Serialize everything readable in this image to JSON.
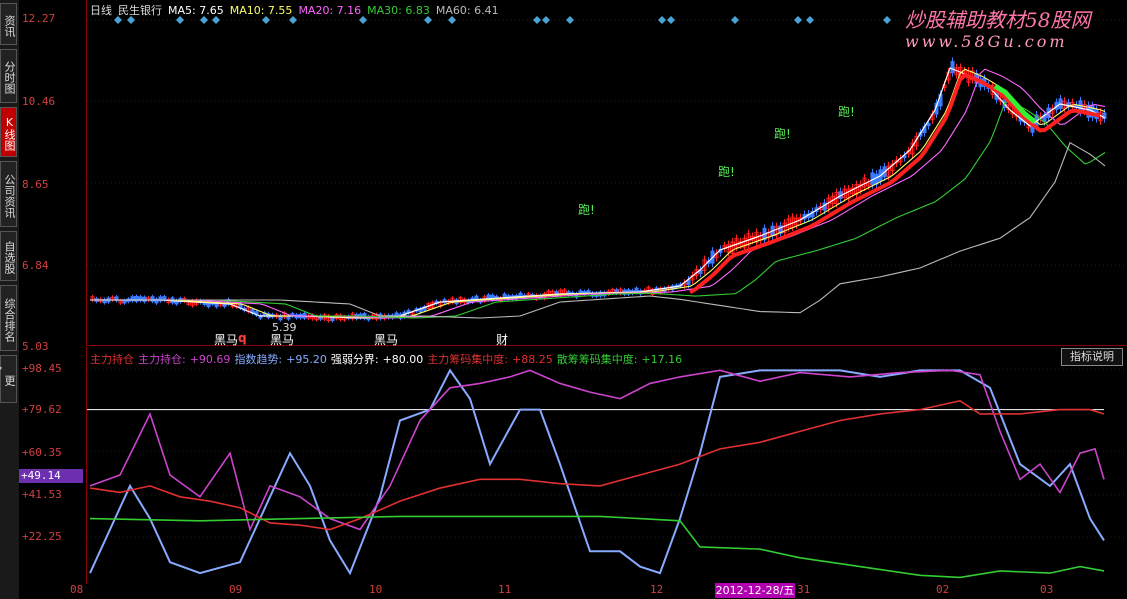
{
  "side_tabs": [
    {
      "label": "资讯",
      "active": false
    },
    {
      "label": "分时图",
      "active": false
    },
    {
      "label": "K线图",
      "active": true
    },
    {
      "label": "公司资讯",
      "active": false
    },
    {
      "label": "自选股",
      "active": false
    },
    {
      "label": "综合排名",
      "active": false
    },
    {
      "label": "更多..",
      "active": false
    }
  ],
  "main_legend": {
    "period": "日线",
    "stock": "民生银行",
    "ma5": "MA5: 7.65",
    "ma10": "MA10: 7.55",
    "ma20": "MA20: 7.16",
    "ma30": "MA30: 6.83",
    "ma60": "MA60: 6.41"
  },
  "main_axis": [
    "12.27",
    "10.46",
    "8.65",
    "6.84",
    "5.03"
  ],
  "annotations": {
    "heima1": "黑马",
    "q": "q",
    "heima2": "黑马",
    "heima3": "黑马",
    "cai": "财",
    "low": "5.39",
    "pao1": "跑!",
    "pao2": "跑!",
    "pao3": "跑!",
    "pao4": "跑!"
  },
  "watermark": {
    "line1": "炒股辅助教材58股网",
    "line2": "www.58Gu.com"
  },
  "ind_legend": {
    "t1": "主力持仓",
    "t2": "主力持仓:",
    "v2": "+90.69",
    "t3": "指数趋势:",
    "v3": "+95.20",
    "t4": "强弱分界:",
    "v4": "+80.00",
    "t5": "主力筹码集中度:",
    "v5": "+88.25",
    "t6": "散筹筹码集中度:",
    "v6": "+17.16"
  },
  "help_button": "指标说明",
  "ind_axis": [
    "+98.45",
    "+79.62",
    "+60.35",
    "+41.53",
    "+22.25"
  ],
  "current_value": "+49.14",
  "x_axis": {
    "m08": "08",
    "m09": "09",
    "m10": "10",
    "m11": "11",
    "m12": "12",
    "m31": "31",
    "m02": "02",
    "m03": "03"
  },
  "date_badge": "2012-12-28/五",
  "colors": {
    "up": "#ff2020",
    "down": "#3a7bff",
    "ma5": "#ffffff",
    "ma10": "#ffff66",
    "ma20": "#ff66ff",
    "ma30": "#33cc33",
    "ma60": "#bbbbbb",
    "chip_main": "#e03030",
    "chip_retail": "#33cc33",
    "trend": "#88aaff",
    "holding": "#cc44cc"
  }
}
